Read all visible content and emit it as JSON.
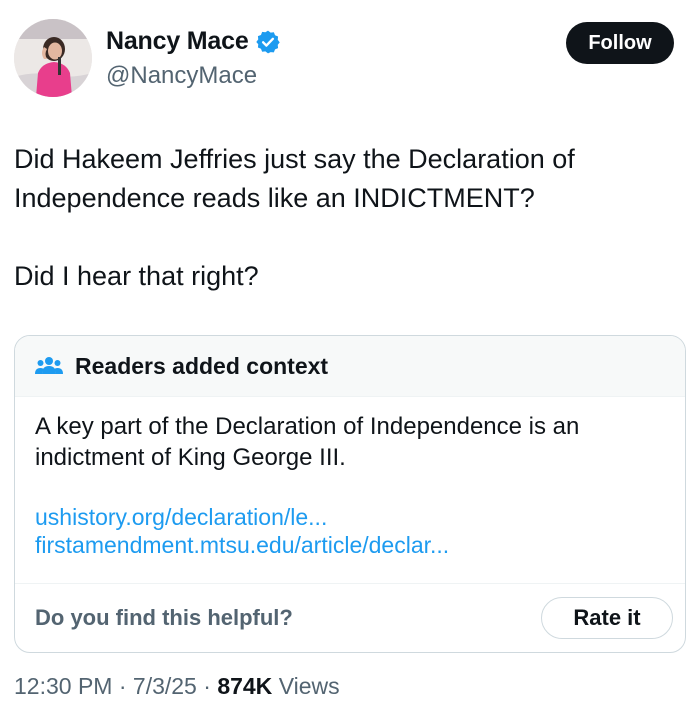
{
  "author": {
    "name": "Nancy Mace",
    "handle": "@NancyMace",
    "verified": true,
    "verified_color": "#1d9bf0",
    "avatar_icon": "profile-photo"
  },
  "follow_button": {
    "label": "Follow"
  },
  "tweet": {
    "paragraphs": [
      "Did Hakeem Jeffries just say the Declaration of Independence reads like an INDICTMENT?",
      "Did I hear that right?"
    ]
  },
  "community_note": {
    "icon": "people-icon",
    "title": "Readers added context",
    "body": "A key part of the Declaration of Independence is an indictment of King George III.",
    "links": [
      "ushistory.org/declaration/le...",
      "firstamendment.mtsu.edu/article/declar..."
    ],
    "helpful_question": "Do you find this helpful?",
    "rate_button": "Rate it"
  },
  "meta": {
    "time": "12:30 PM",
    "date": "7/3/25",
    "separator": "·",
    "views_count": "874K",
    "views_label": "Views"
  }
}
